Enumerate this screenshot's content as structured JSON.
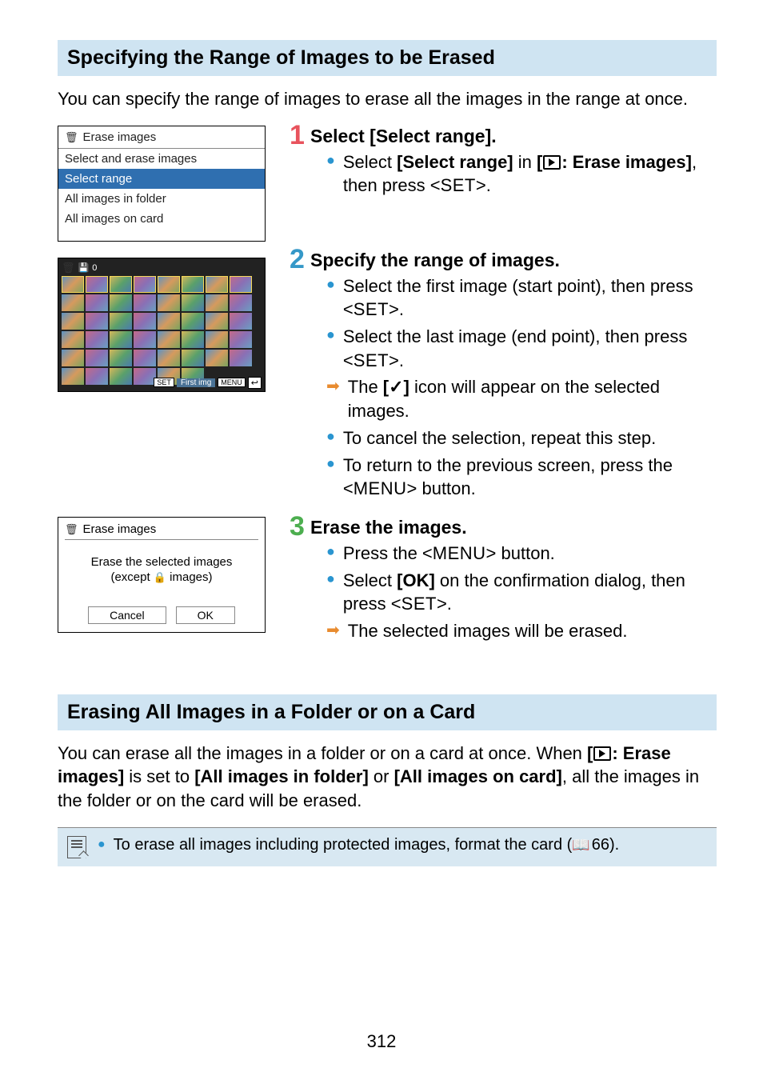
{
  "section1": {
    "title": "Specifying the Range of Images to be Erased",
    "intro": "You can specify the range of images to erase all the images in the range at once."
  },
  "camMenu": {
    "header": "Erase images",
    "items": [
      "Select and erase images",
      "Select range",
      "All images in folder",
      "All images on card"
    ]
  },
  "thumbShot": {
    "count": "0",
    "footer_set": "SET",
    "footer_label": "First img",
    "footer_menu": "MENU"
  },
  "confirm": {
    "header": "Erase images",
    "line1": "Erase the selected images",
    "line2": "(except ",
    "line2_suffix": " images)",
    "cancel": "Cancel",
    "ok": "OK"
  },
  "step1": {
    "title": "Select [Select range].",
    "b1a": "Select ",
    "b1b": "[Select range]",
    "b1c": " in ",
    "b1d": "[",
    "b1e": ": Erase images]",
    "b1f": ", then press <",
    "b1g": "SET",
    "b1h": ">."
  },
  "step2": {
    "title": "Specify the range of images.",
    "b1": "Select the first image (start point), then press <",
    "set": "SET",
    "b1b": ">.",
    "b2": "Select the last image (end point), then press <",
    "b2b": ">.",
    "b3a": "The ",
    "b3b": "[✓]",
    "b3c": " icon will appear on the selected images.",
    "b4": "To cancel the selection, repeat this step.",
    "b5a": "To return to the previous screen, press the <",
    "menu": "MENU",
    "b5b": "> button."
  },
  "step3": {
    "title": "Erase the images.",
    "b1a": "Press the <",
    "b1b": "> button.",
    "b2a": "Select ",
    "b2b": "[OK]",
    "b2c": " on the confirmation dialog, then press <",
    "b2d": ">.",
    "b3": "The selected images will be erased."
  },
  "section2": {
    "title": "Erasing All Images in a Folder or on a Card",
    "p1a": "You can erase all the images in a folder or on a card at once. When ",
    "p1b": "[",
    "p1c": ": Erase images]",
    "p1d": " is set to ",
    "p1e": "[All images in folder]",
    "p1f": " or ",
    "p1g": "[All images on card]",
    "p1h": ", all the images in the folder or on the card will be erased."
  },
  "note": {
    "text_a": "To erase all images including protected images, format the card (",
    "ref": "66",
    "text_b": ")."
  },
  "pageNumber": "312"
}
